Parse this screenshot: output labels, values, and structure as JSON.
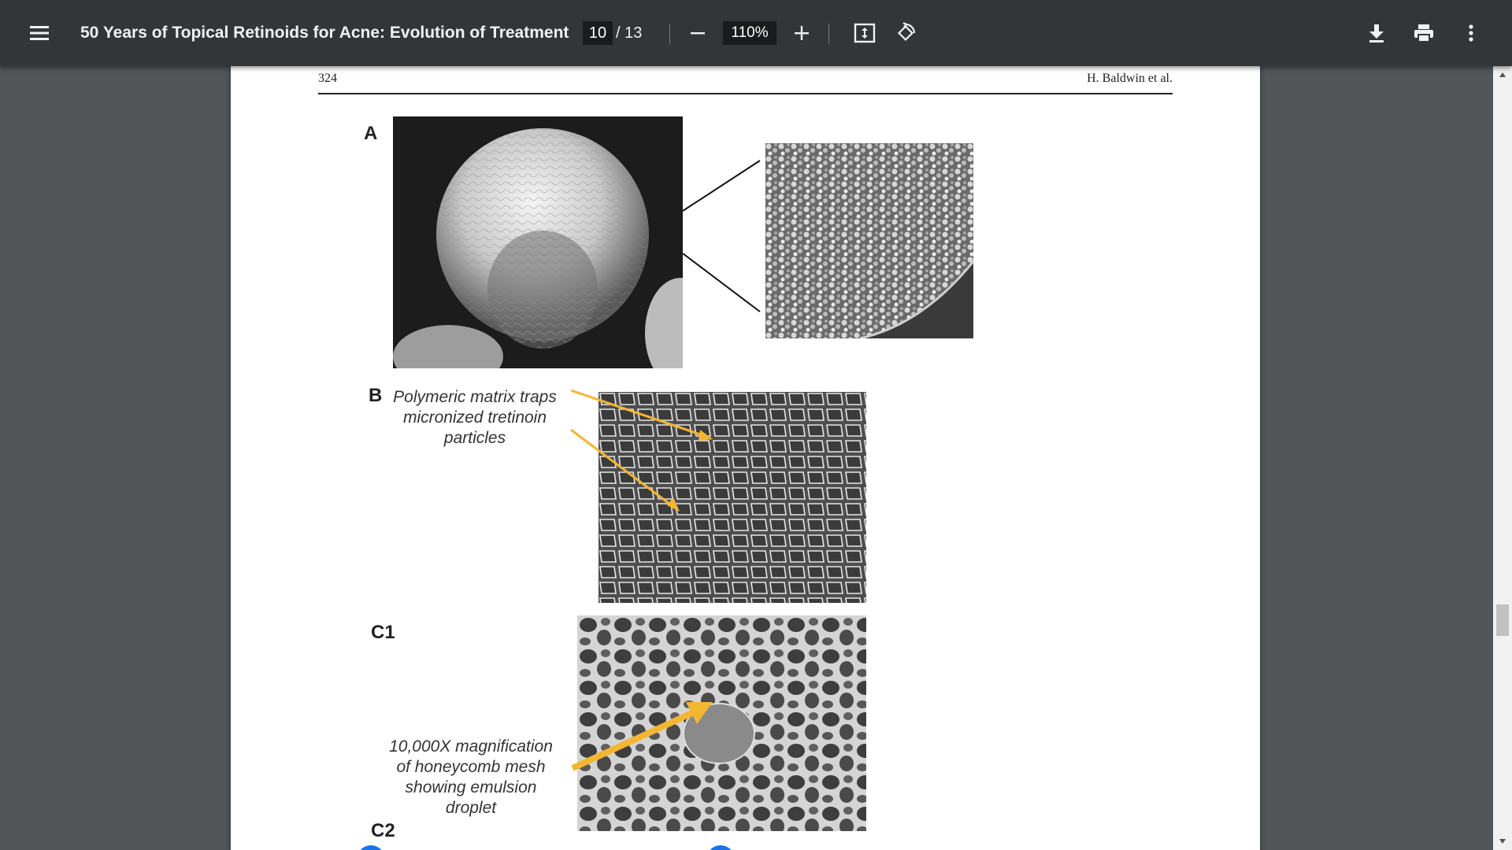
{
  "toolbar": {
    "title": "50 Years of Topical Retinoids for Acne: Evolution of Treatment",
    "page_current": "10",
    "page_total": "/ 13",
    "zoom": "110%"
  },
  "page": {
    "header_page_number": "324",
    "header_author": "H. Baldwin et al.",
    "panels": {
      "a_label": "A",
      "b_label": "B",
      "c1_label": "C1",
      "c2_label": "C2"
    },
    "captions": {
      "b_line1": "Polymeric matrix traps",
      "b_line2": "micronized tretinoin",
      "b_line3": "particles",
      "c1_line1": "10,000X magnification",
      "c1_line2": "of honeycomb mesh",
      "c1_line3": "showing emulsion",
      "c1_line4": "droplet"
    }
  },
  "colors": {
    "toolbar_bg": "#323639",
    "viewer_bg": "#525659",
    "annotation_arrow": "#f2b632",
    "marker_blue": "#1a73e8"
  },
  "icons": [
    "menu-icon",
    "minus-icon",
    "plus-icon",
    "fit-page-icon",
    "rotate-icon",
    "download-icon",
    "print-icon",
    "more-vert-icon"
  ]
}
